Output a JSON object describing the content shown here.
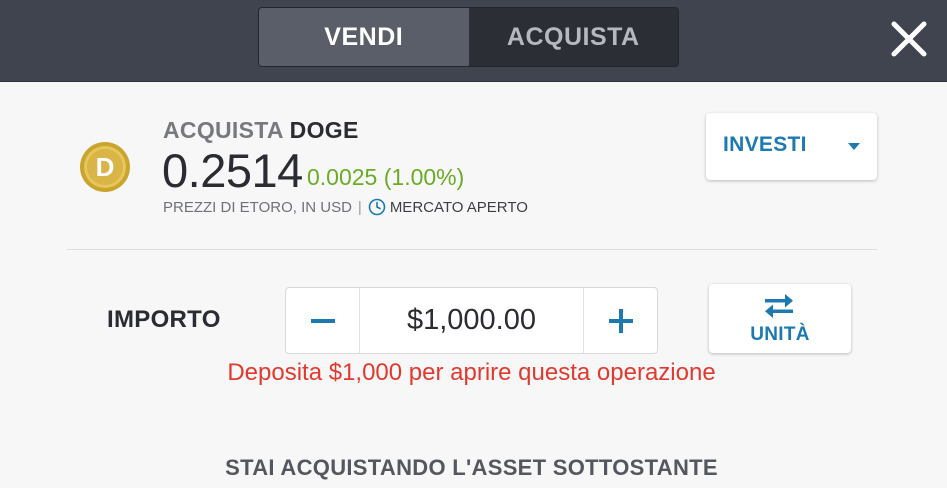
{
  "header": {
    "toggle": {
      "sell_label": "VENDI",
      "buy_label": "ACQUISTA"
    },
    "close_icon": "close-icon"
  },
  "asset": {
    "logo_icon": "dogecoin-logo-icon",
    "action_verb": "ACQUISTA",
    "symbol": "DOGE",
    "price": "0.2514",
    "change": "0.0025 (1.00%)",
    "price_source": "PREZZI DI ETORO, IN USD",
    "separator": "|",
    "market_status": "MERCATO APERTO"
  },
  "invest_dropdown": {
    "label": "INVESTI"
  },
  "amount": {
    "label": "IMPORTO",
    "value": "$1,000.00",
    "minus_label": "−",
    "plus_label": "+"
  },
  "units_button": {
    "label": "UNITÀ"
  },
  "warning": "Deposita $1,000 per aprire questa operazione",
  "underlying_note": "STAI ACQUISTANDO L'ASSET SOTTOSTANTE",
  "colors": {
    "accent_blue": "#1d7ab0",
    "positive_green": "#6bab26",
    "error_red": "#e03a2f",
    "header_bg": "#40444e",
    "doge_gold": "#c9a530"
  }
}
